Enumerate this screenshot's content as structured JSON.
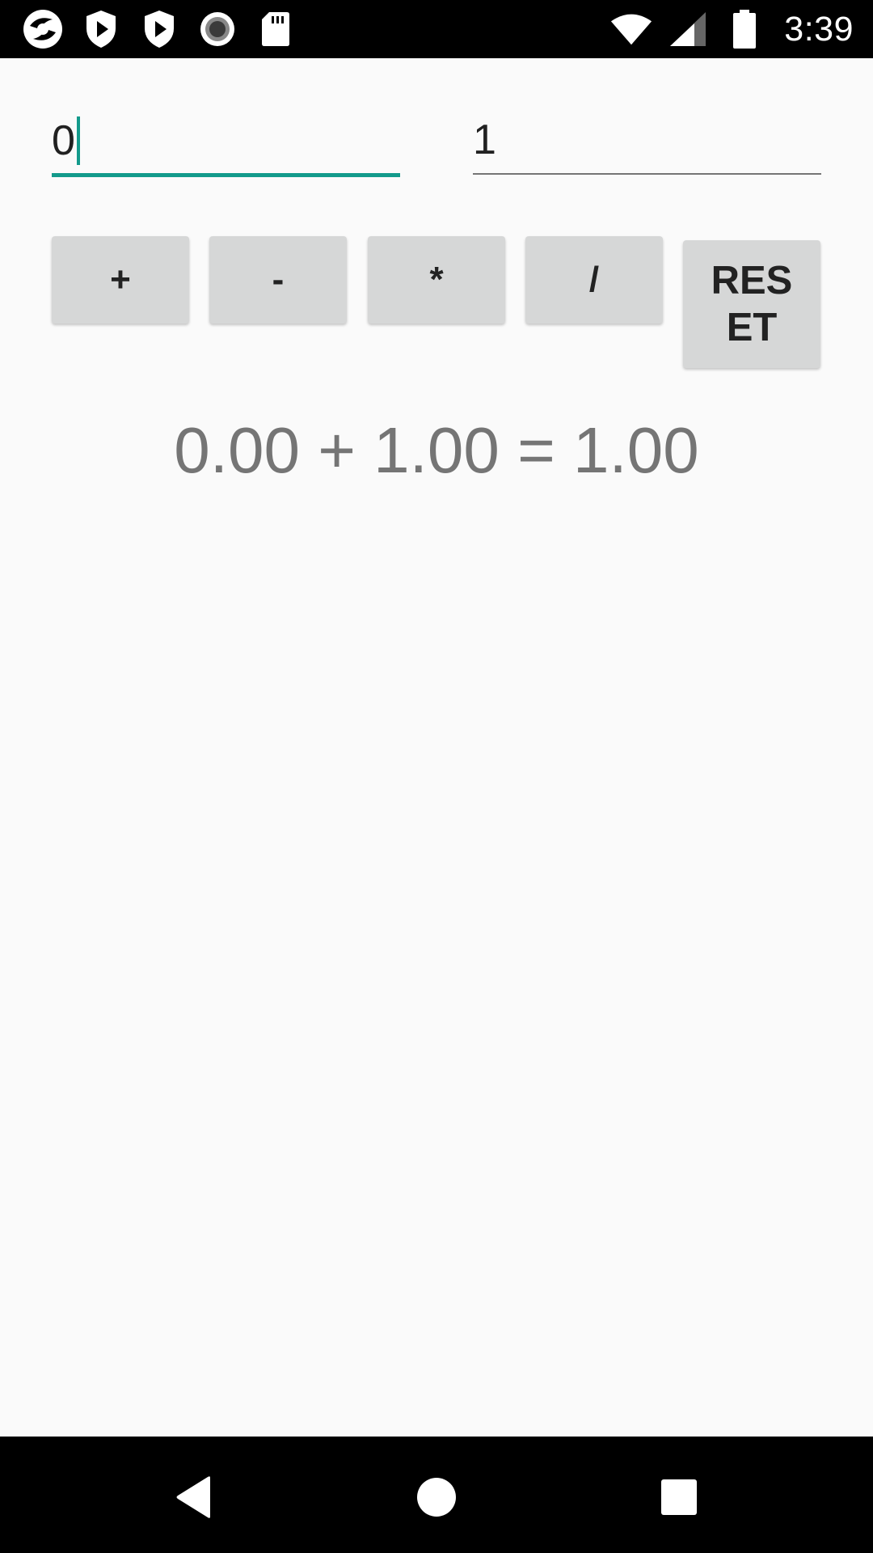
{
  "status_bar": {
    "time": "3:39",
    "left_icons": [
      "app-logo-icon",
      "shield-play-icon",
      "shield-play-icon",
      "record-icon",
      "sd-card-icon"
    ],
    "right_icons": [
      "wifi-icon",
      "cell-signal-icon",
      "battery-icon"
    ]
  },
  "inputs": {
    "first_value": "0",
    "second_value": "1",
    "focus_color": "#139a8b"
  },
  "buttons": {
    "add": "+",
    "subtract": "-",
    "multiply": "*",
    "divide": "/",
    "reset": "RESET"
  },
  "result": {
    "text": "0.00 + 1.00 = 1.00"
  },
  "nav_bar": {
    "icons": [
      "back-icon",
      "home-icon",
      "recent-apps-icon"
    ]
  }
}
